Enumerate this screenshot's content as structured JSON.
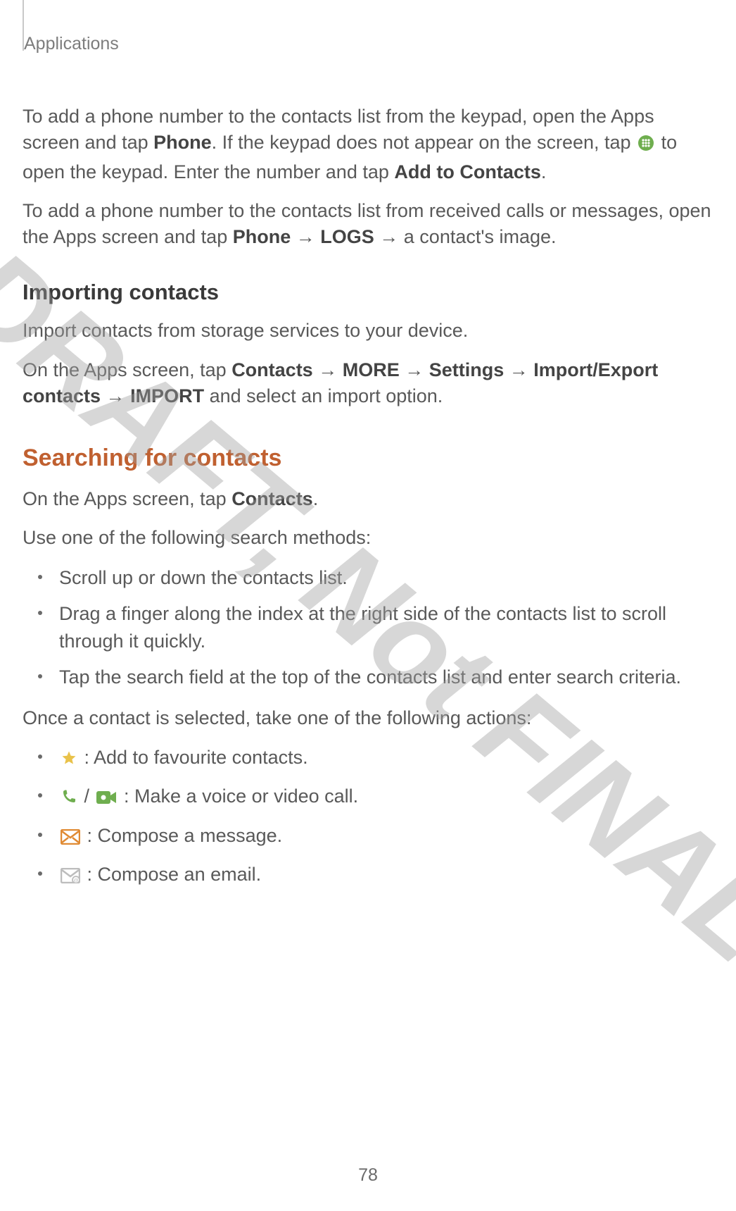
{
  "header": "Applications",
  "page_number": "78",
  "watermark": "DRAFT, Not FINAL",
  "para1": {
    "pre": "To add a phone number to the contacts list from the keypad, open the Apps screen and tap ",
    "b1": "Phone",
    "mid1": ". If the keypad does not appear on the screen, tap ",
    "mid2": " to open the keypad. Enter the number and tap ",
    "b2": "Add to Contacts",
    "post": "."
  },
  "para2": {
    "pre": "To add a phone number to the contacts list from received calls or messages, open the Apps screen and tap ",
    "b1": "Phone",
    "arrow1": " → ",
    "b2": "LOGS",
    "arrow2": " → ",
    "post": "a contact's image."
  },
  "importing": {
    "heading": "Importing contacts",
    "p1": "Import contacts from storage services to your device.",
    "p2_pre": "On the Apps screen, tap ",
    "p2_b1": "Contacts",
    "p2_a1": " → ",
    "p2_b2": "MORE",
    "p2_a2": " → ",
    "p2_b3": "Settings",
    "p2_a3": " → ",
    "p2_b4": "Import/Export contacts",
    "p2_a4": " → ",
    "p2_b5": "IMPORT",
    "p2_post": " and select an import option."
  },
  "searching": {
    "heading": "Searching for contacts",
    "p1_pre": "On the Apps screen, tap ",
    "p1_b1": "Contacts",
    "p1_post": ".",
    "p2": "Use one of the following search methods:",
    "methods": [
      "Scroll up or down the contacts list.",
      "Drag a finger along the index at the right side of the contacts list to scroll through it quickly.",
      "Tap the search field at the top of the contacts list and enter search criteria."
    ],
    "p3": "Once a contact is selected, take one of the following actions:",
    "actions": {
      "fav": " : Add to favourite contacts.",
      "call_sep": " / ",
      "call": " : Make a voice or video call.",
      "msg": " : Compose a message.",
      "email": " : Compose an email."
    }
  },
  "icons": {
    "keypad": "keypad-icon",
    "star": "star-icon",
    "phone": "phone-icon",
    "video": "video-icon",
    "message": "message-icon",
    "email": "email-icon"
  },
  "colors": {
    "accent_orange": "#c06030",
    "icon_green": "#6fae4f",
    "icon_star": "#e9c24a",
    "icon_orange": "#e08a33",
    "icon_grey": "#bdbdbd"
  }
}
